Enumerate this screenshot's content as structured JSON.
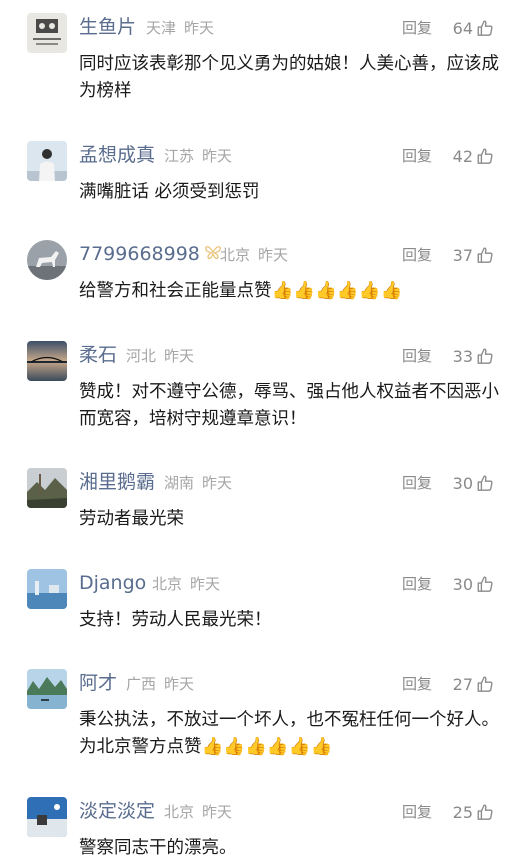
{
  "ui": {
    "reply_label": "回复"
  },
  "comments": [
    {
      "name": "生鱼片",
      "location": "天津",
      "time": "昨天",
      "likes": "64",
      "text": "同时应该表彰那个见义勇为的姑娘！人美心善，应该成为榜样",
      "avatar_icon": "seal-stamp-icon"
    },
    {
      "name": "孟想成真",
      "location": "江苏",
      "time": "昨天",
      "likes": "42",
      "text": "满嘴脏话 必须受到惩罚",
      "avatar_icon": "person-photo-icon"
    },
    {
      "name": "7799668998",
      "location": "北京",
      "time": "昨天",
      "likes": "37",
      "text": "给警方和社会正能量点赞👍👍👍👍👍👍",
      "avatar_icon": "horse-photo-icon",
      "badge_icon": "butterfly-icon"
    },
    {
      "name": "柔石",
      "location": "河北",
      "time": "昨天",
      "likes": "33",
      "text": "赞成！对不遵守公德，辱骂、强占他人权益者不因恶小而宽容，培树守规遵章意识！",
      "avatar_icon": "sunset-lake-icon"
    },
    {
      "name": "湘里鹅霸",
      "location": "湖南",
      "time": "昨天",
      "likes": "30",
      "text": "劳动者最光荣",
      "avatar_icon": "landscape-photo-icon"
    },
    {
      "name": "Django",
      "location": "北京",
      "time": "昨天",
      "likes": "30",
      "text": "支持！劳动人民最光荣！",
      "avatar_icon": "sea-photo-icon"
    },
    {
      "name": "阿才",
      "location": "广西",
      "time": "昨天",
      "likes": "27",
      "text": "秉公执法，不放过一个坏人，也不冤枉任何一个好人。为北京警方点赞👍👍👍👍👍👍",
      "avatar_icon": "river-mountain-icon"
    },
    {
      "name": "淡定淡定",
      "location": "北京",
      "time": "昨天",
      "likes": "25",
      "text": "警察同志干的漂亮。",
      "avatar_icon": "sky-photo-icon"
    }
  ],
  "colors": {
    "name": "#5a6d8e",
    "meta": "#a6a6a6",
    "text": "#1a1a1a",
    "badge": "#e8c27a"
  }
}
